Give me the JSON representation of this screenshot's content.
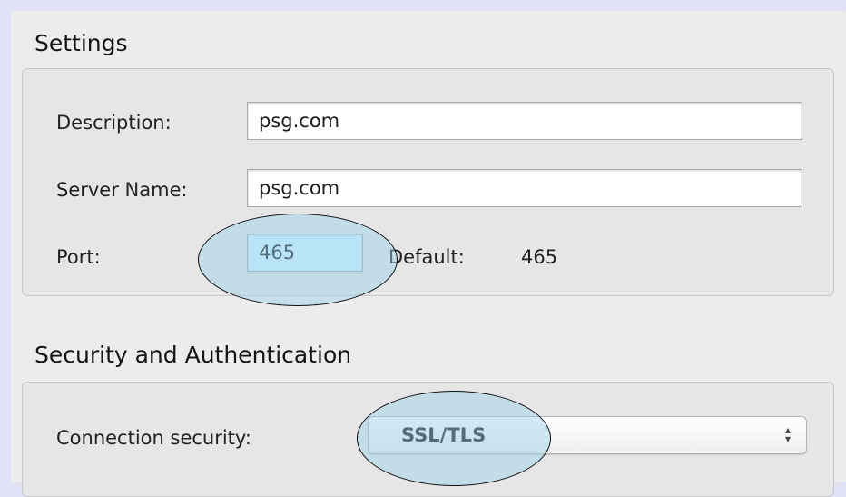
{
  "settings": {
    "title": "Settings",
    "description": {
      "label": "Description:",
      "value": "psg.com"
    },
    "server_name": {
      "label": "Server Name:",
      "value": "psg.com"
    },
    "port": {
      "label": "Port:",
      "value": "465",
      "default_label": "Default:",
      "default_value": "465"
    }
  },
  "security": {
    "title": "Security and Authentication",
    "connection_security": {
      "label": "Connection security:",
      "selected": "SSL/TLS"
    }
  },
  "icons": {
    "select_arrows": "up-down-arrows-icon"
  },
  "colors": {
    "background": "#e2e2f6",
    "panel": "#ececec",
    "annotation_fill": "#96d2eb",
    "port_field": "#d6f1ff"
  }
}
